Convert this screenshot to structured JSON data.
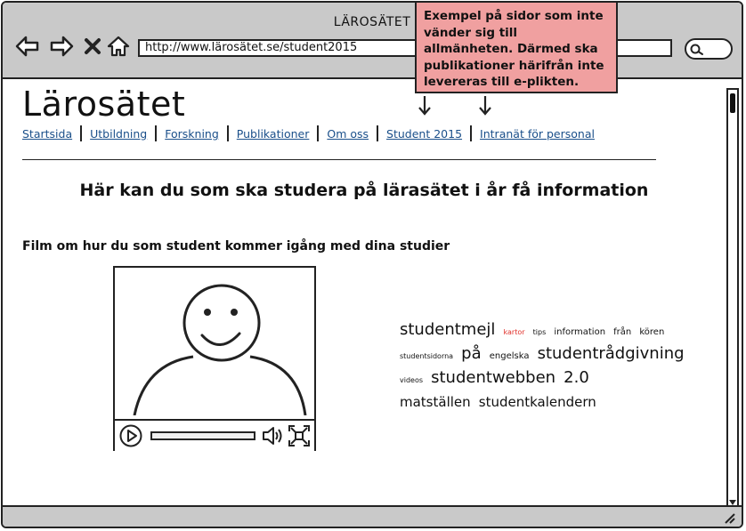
{
  "window": {
    "title": "LÄROSÄTET"
  },
  "toolbar": {
    "back_icon": "arrow-left-icon",
    "forward_icon": "arrow-right-icon",
    "stop_icon": "close-icon",
    "home_icon": "home-icon",
    "url": "http://www.lärosätet.se/student2015",
    "search_icon": "search-icon"
  },
  "site": {
    "title": "Lärosätet",
    "menu": [
      {
        "label": "Startsida"
      },
      {
        "label": "Utbildning"
      },
      {
        "label": "Forskning"
      },
      {
        "label": "Publikationer"
      },
      {
        "label": "Om oss"
      },
      {
        "label": "Student 2015"
      },
      {
        "label": "Intranät för personal"
      }
    ]
  },
  "main": {
    "headline": "Här kan du som ska studera på lärasätet i år få information",
    "video_caption": "Film om hur du som student kommer igång med dina studier",
    "tag_cloud": [
      {
        "text": "studentmejl",
        "size": "big"
      },
      {
        "text": "kartor",
        "size": "xs",
        "color": "#e0302a"
      },
      {
        "text": "tips",
        "size": "xs"
      },
      {
        "text": "information",
        "size": "sm"
      },
      {
        "text": "från",
        "size": "sm"
      },
      {
        "text": "kören",
        "size": "sm"
      },
      {
        "text": "studentsidorna",
        "size": "xs"
      },
      {
        "text": "på",
        "size": "big"
      },
      {
        "text": "engelska",
        "size": "sm"
      },
      {
        "text": "studentrådgivning",
        "size": "big"
      },
      {
        "text": "videos",
        "size": "xs"
      },
      {
        "text": "studentwebben",
        "size": "big"
      },
      {
        "text": "2.0",
        "size": "big"
      },
      {
        "text": "matställen",
        "size": "med"
      },
      {
        "text": "studentkalendern",
        "size": "med"
      }
    ]
  },
  "annotation": {
    "text": "Exempel på sidor som inte vänder sig till allmänheten. Därmed ska publikationer härifrån inte levereras till e-plikten."
  }
}
